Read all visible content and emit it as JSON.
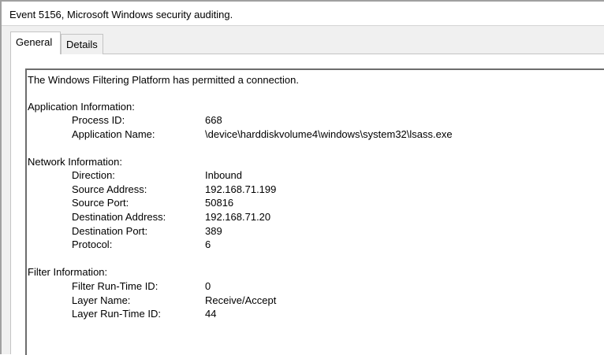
{
  "window": {
    "title": "Event 5156, Microsoft Windows security auditing."
  },
  "tabs": [
    {
      "label": "General",
      "selected": true
    },
    {
      "label": "Details",
      "selected": false
    }
  ],
  "event": {
    "summary": "The Windows Filtering Platform has permitted a connection.",
    "application": {
      "header": "Application Information:",
      "process_id_label": "Process ID:",
      "process_id": "668",
      "app_name_label": "Application Name:",
      "app_name": "\\device\\harddiskvolume4\\windows\\system32\\lsass.exe"
    },
    "network": {
      "header": "Network Information:",
      "direction_label": "Direction:",
      "direction": "Inbound",
      "source_address_label": "Source Address:",
      "source_address": "192.168.71.199",
      "source_port_label": "Source Port:",
      "source_port": "50816",
      "destination_address_label": "Destination Address:",
      "destination_address": "192.168.71.20",
      "destination_port_label": "Destination Port:",
      "destination_port": "389",
      "protocol_label": "Protocol:",
      "protocol": "6"
    },
    "filter": {
      "header": "Filter Information:",
      "filter_runtime_id_label": "Filter Run-Time ID:",
      "filter_runtime_id": "0",
      "layer_name_label": "Layer Name:",
      "layer_name": "Receive/Accept",
      "layer_runtime_id_label": "Layer Run-Time ID:",
      "layer_runtime_id": "44"
    }
  }
}
